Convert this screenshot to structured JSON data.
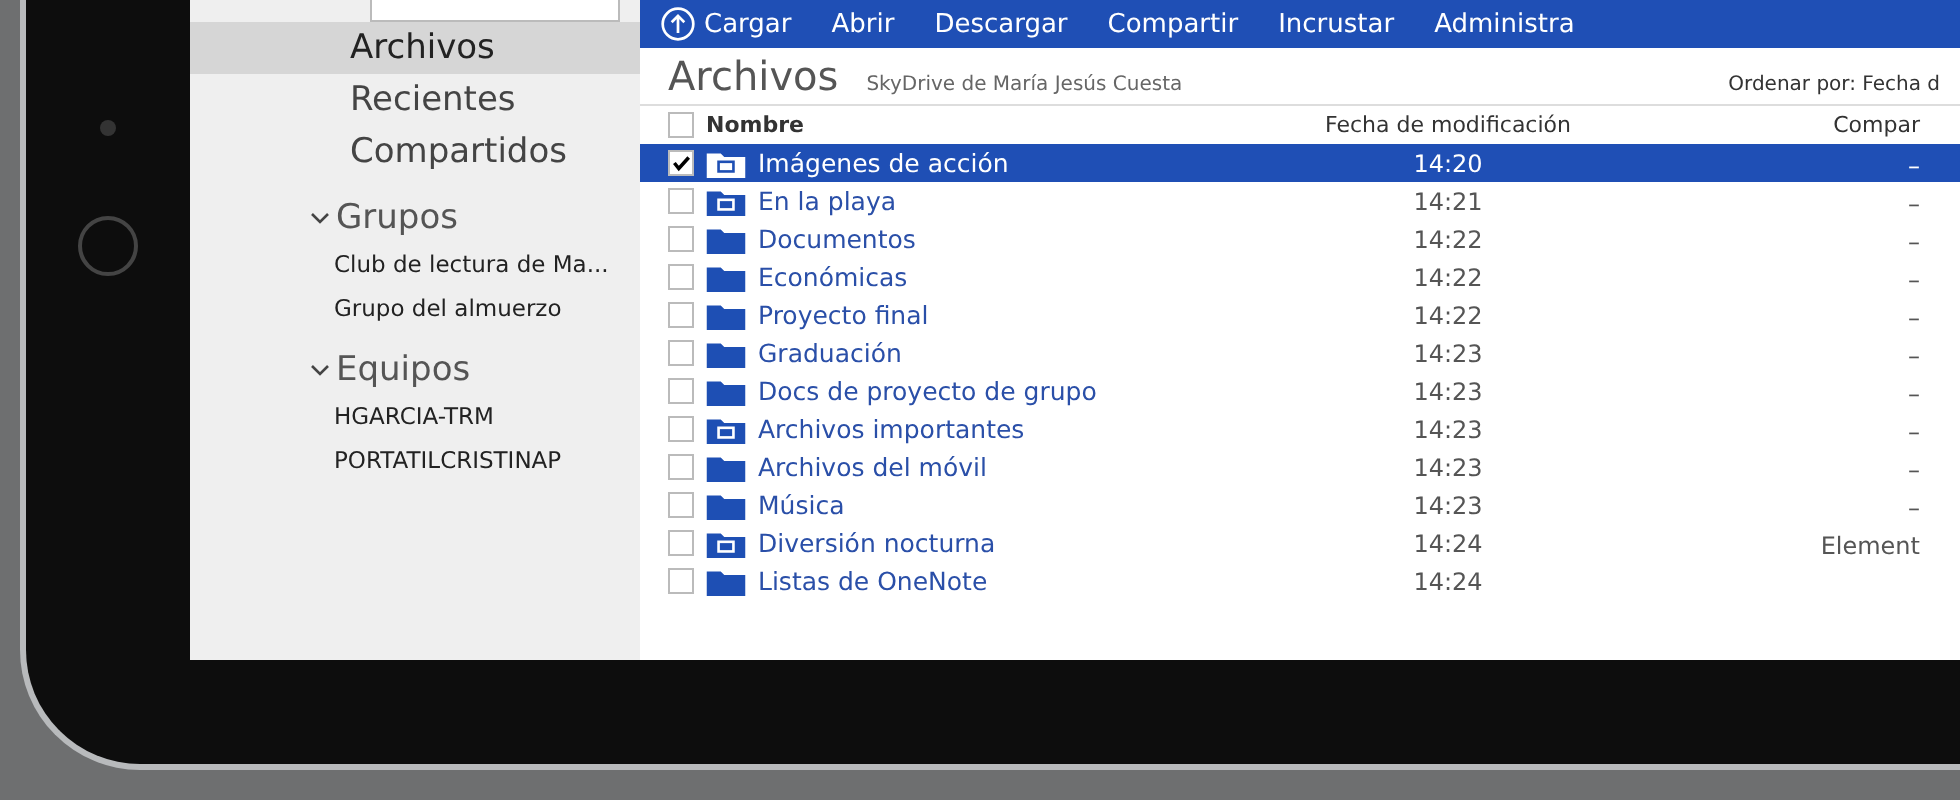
{
  "sidebar": {
    "items": [
      {
        "label": "Archivos",
        "selected": true
      },
      {
        "label": "Recientes",
        "selected": false
      },
      {
        "label": "Compartidos",
        "selected": false
      }
    ],
    "sections": [
      {
        "title": "Grupos",
        "expanded": true,
        "items": [
          "Club de lectura de Ma...",
          "Grupo del almuerzo"
        ]
      },
      {
        "title": "Equipos",
        "expanded": true,
        "items": [
          "HGARCIA-TRM",
          "PORTATILCRISTINAP"
        ]
      }
    ]
  },
  "toolbar": {
    "items": [
      {
        "label": "Cargar",
        "kind": "upload"
      },
      {
        "label": "Abrir",
        "kind": "plain"
      },
      {
        "label": "Descargar",
        "kind": "plain"
      },
      {
        "label": "Compartir",
        "kind": "plain"
      },
      {
        "label": "Incrustar",
        "kind": "plain"
      },
      {
        "label": "Administra",
        "kind": "plain"
      }
    ]
  },
  "title": "Archivos",
  "subtitle": "SkyDrive de María Jesús Cuesta",
  "sort": "Ordenar por: Fecha d",
  "select_all": {
    "checked": false
  },
  "table": {
    "columns": [
      "Nombre",
      "Fecha de modificación",
      "Compar"
    ],
    "rows": [
      {
        "name": "Imágenes de acción",
        "kind": "photo-folder",
        "date": "14:20",
        "sharing": "–",
        "selected": true
      },
      {
        "name": "En la playa",
        "kind": "photo-folder",
        "date": "14:21",
        "sharing": "–",
        "selected": false
      },
      {
        "name": "Documentos",
        "kind": "folder",
        "date": "14:22",
        "sharing": "–",
        "selected": false
      },
      {
        "name": "Económicas",
        "kind": "folder",
        "date": "14:22",
        "sharing": "–",
        "selected": false
      },
      {
        "name": "Proyecto final",
        "kind": "folder",
        "date": "14:22",
        "sharing": "–",
        "selected": false
      },
      {
        "name": "Graduación",
        "kind": "folder",
        "date": "14:23",
        "sharing": "–",
        "selected": false
      },
      {
        "name": "Docs de proyecto de grupo",
        "kind": "folder",
        "date": "14:23",
        "sharing": "–",
        "selected": false
      },
      {
        "name": "Archivos importantes",
        "kind": "photo-folder",
        "date": "14:23",
        "sharing": "–",
        "selected": false
      },
      {
        "name": "Archivos del móvil",
        "kind": "folder",
        "date": "14:23",
        "sharing": "–",
        "selected": false
      },
      {
        "name": "Música",
        "kind": "folder",
        "date": "14:23",
        "sharing": "–",
        "selected": false
      },
      {
        "name": "Diversión nocturna",
        "kind": "photo-folder",
        "date": "14:24",
        "sharing": "Element",
        "selected": false
      },
      {
        "name": "Listas de OneNote",
        "kind": "folder",
        "date": "14:24",
        "selected": false
      }
    ]
  }
}
